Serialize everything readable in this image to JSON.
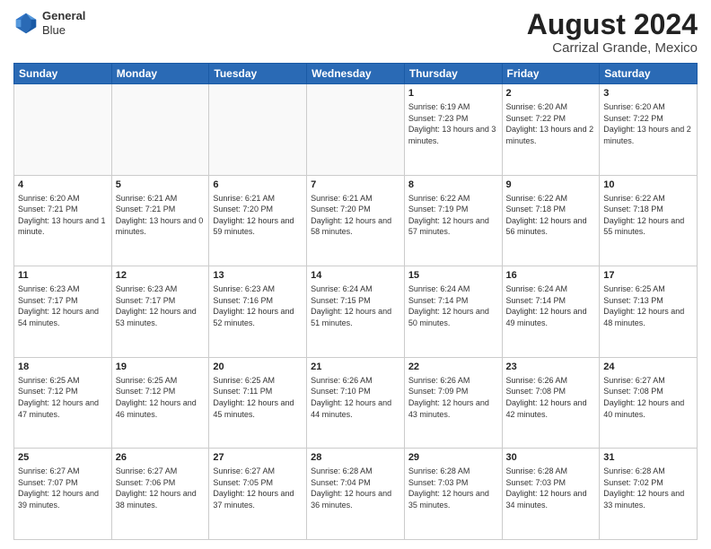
{
  "header": {
    "logo_line1": "General",
    "logo_line2": "Blue",
    "month_year": "August 2024",
    "location": "Carrizal Grande, Mexico"
  },
  "weekdays": [
    "Sunday",
    "Monday",
    "Tuesday",
    "Wednesday",
    "Thursday",
    "Friday",
    "Saturday"
  ],
  "weeks": [
    [
      {
        "day": "",
        "info": ""
      },
      {
        "day": "",
        "info": ""
      },
      {
        "day": "",
        "info": ""
      },
      {
        "day": "",
        "info": ""
      },
      {
        "day": "1",
        "info": "Sunrise: 6:19 AM\nSunset: 7:23 PM\nDaylight: 13 hours\nand 3 minutes."
      },
      {
        "day": "2",
        "info": "Sunrise: 6:20 AM\nSunset: 7:22 PM\nDaylight: 13 hours\nand 2 minutes."
      },
      {
        "day": "3",
        "info": "Sunrise: 6:20 AM\nSunset: 7:22 PM\nDaylight: 13 hours\nand 2 minutes."
      }
    ],
    [
      {
        "day": "4",
        "info": "Sunrise: 6:20 AM\nSunset: 7:21 PM\nDaylight: 13 hours\nand 1 minute."
      },
      {
        "day": "5",
        "info": "Sunrise: 6:21 AM\nSunset: 7:21 PM\nDaylight: 13 hours\nand 0 minutes."
      },
      {
        "day": "6",
        "info": "Sunrise: 6:21 AM\nSunset: 7:20 PM\nDaylight: 12 hours\nand 59 minutes."
      },
      {
        "day": "7",
        "info": "Sunrise: 6:21 AM\nSunset: 7:20 PM\nDaylight: 12 hours\nand 58 minutes."
      },
      {
        "day": "8",
        "info": "Sunrise: 6:22 AM\nSunset: 7:19 PM\nDaylight: 12 hours\nand 57 minutes."
      },
      {
        "day": "9",
        "info": "Sunrise: 6:22 AM\nSunset: 7:18 PM\nDaylight: 12 hours\nand 56 minutes."
      },
      {
        "day": "10",
        "info": "Sunrise: 6:22 AM\nSunset: 7:18 PM\nDaylight: 12 hours\nand 55 minutes."
      }
    ],
    [
      {
        "day": "11",
        "info": "Sunrise: 6:23 AM\nSunset: 7:17 PM\nDaylight: 12 hours\nand 54 minutes."
      },
      {
        "day": "12",
        "info": "Sunrise: 6:23 AM\nSunset: 7:17 PM\nDaylight: 12 hours\nand 53 minutes."
      },
      {
        "day": "13",
        "info": "Sunrise: 6:23 AM\nSunset: 7:16 PM\nDaylight: 12 hours\nand 52 minutes."
      },
      {
        "day": "14",
        "info": "Sunrise: 6:24 AM\nSunset: 7:15 PM\nDaylight: 12 hours\nand 51 minutes."
      },
      {
        "day": "15",
        "info": "Sunrise: 6:24 AM\nSunset: 7:14 PM\nDaylight: 12 hours\nand 50 minutes."
      },
      {
        "day": "16",
        "info": "Sunrise: 6:24 AM\nSunset: 7:14 PM\nDaylight: 12 hours\nand 49 minutes."
      },
      {
        "day": "17",
        "info": "Sunrise: 6:25 AM\nSunset: 7:13 PM\nDaylight: 12 hours\nand 48 minutes."
      }
    ],
    [
      {
        "day": "18",
        "info": "Sunrise: 6:25 AM\nSunset: 7:12 PM\nDaylight: 12 hours\nand 47 minutes."
      },
      {
        "day": "19",
        "info": "Sunrise: 6:25 AM\nSunset: 7:12 PM\nDaylight: 12 hours\nand 46 minutes."
      },
      {
        "day": "20",
        "info": "Sunrise: 6:25 AM\nSunset: 7:11 PM\nDaylight: 12 hours\nand 45 minutes."
      },
      {
        "day": "21",
        "info": "Sunrise: 6:26 AM\nSunset: 7:10 PM\nDaylight: 12 hours\nand 44 minutes."
      },
      {
        "day": "22",
        "info": "Sunrise: 6:26 AM\nSunset: 7:09 PM\nDaylight: 12 hours\nand 43 minutes."
      },
      {
        "day": "23",
        "info": "Sunrise: 6:26 AM\nSunset: 7:08 PM\nDaylight: 12 hours\nand 42 minutes."
      },
      {
        "day": "24",
        "info": "Sunrise: 6:27 AM\nSunset: 7:08 PM\nDaylight: 12 hours\nand 40 minutes."
      }
    ],
    [
      {
        "day": "25",
        "info": "Sunrise: 6:27 AM\nSunset: 7:07 PM\nDaylight: 12 hours\nand 39 minutes."
      },
      {
        "day": "26",
        "info": "Sunrise: 6:27 AM\nSunset: 7:06 PM\nDaylight: 12 hours\nand 38 minutes."
      },
      {
        "day": "27",
        "info": "Sunrise: 6:27 AM\nSunset: 7:05 PM\nDaylight: 12 hours\nand 37 minutes."
      },
      {
        "day": "28",
        "info": "Sunrise: 6:28 AM\nSunset: 7:04 PM\nDaylight: 12 hours\nand 36 minutes."
      },
      {
        "day": "29",
        "info": "Sunrise: 6:28 AM\nSunset: 7:03 PM\nDaylight: 12 hours\nand 35 minutes."
      },
      {
        "day": "30",
        "info": "Sunrise: 6:28 AM\nSunset: 7:03 PM\nDaylight: 12 hours\nand 34 minutes."
      },
      {
        "day": "31",
        "info": "Sunrise: 6:28 AM\nSunset: 7:02 PM\nDaylight: 12 hours\nand 33 minutes."
      }
    ]
  ]
}
